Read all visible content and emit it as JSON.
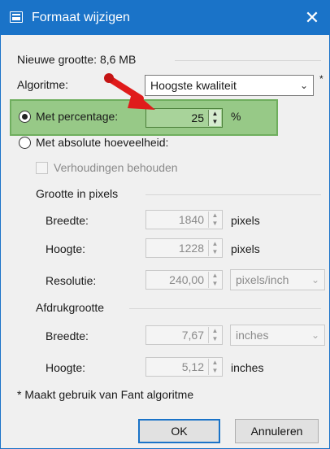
{
  "window": {
    "title": "Formaat wijzigen",
    "close_glyph": "✕",
    "icon": "resize-window-icon"
  },
  "new_size_label": "Nieuwe grootte: 8,6 MB",
  "algorithm": {
    "label": "Algoritme:",
    "value": "Hoogste kwaliteit",
    "asterisk": "*"
  },
  "percentage": {
    "label": "Met percentage:",
    "value": "25",
    "unit": "%",
    "selected": true
  },
  "absolute": {
    "label": "Met absolute hoeveelheid:",
    "selected": false,
    "keep_ratio_label": "Verhoudingen behouden",
    "keep_ratio_checked": false
  },
  "pixel_size": {
    "heading": "Grootte in pixels",
    "width_label": "Breedte:",
    "width_value": "1840",
    "width_unit": "pixels",
    "height_label": "Hoogte:",
    "height_value": "1228",
    "height_unit": "pixels",
    "resolution_label": "Resolutie:",
    "resolution_value": "240,00",
    "resolution_unit": "pixels/inch"
  },
  "print_size": {
    "heading": "Afdrukgrootte",
    "width_label": "Breedte:",
    "width_value": "7,67",
    "width_unit": "inches",
    "height_label": "Hoogte:",
    "height_value": "5,12",
    "height_unit": "inches"
  },
  "footnote": "* Maakt gebruik van Fant algoritme",
  "buttons": {
    "ok": "OK",
    "cancel": "Annuleren"
  },
  "annotation": {
    "arrow_color": "#e01b1b",
    "highlight_color": "#97c987"
  },
  "colors": {
    "titlebar": "#1a73c8",
    "accent_border": "#1a73c8"
  }
}
